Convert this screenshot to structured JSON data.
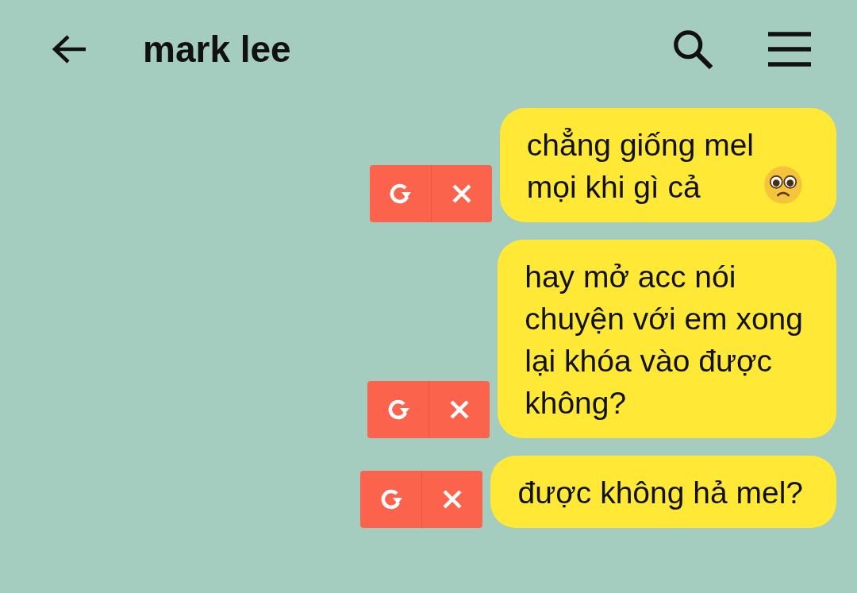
{
  "header": {
    "title": "mark lee"
  },
  "messages": [
    {
      "text": "chẳng giống mel\nmọi khi gì cả",
      "emoji": true,
      "failed": true
    },
    {
      "text": "hay mở acc nói\nchuyện với em xong\nlại khóa vào được\nkhông?",
      "emoji": false,
      "failed": true
    },
    {
      "text": "được không hả mel?",
      "emoji": false,
      "failed": true
    }
  ]
}
